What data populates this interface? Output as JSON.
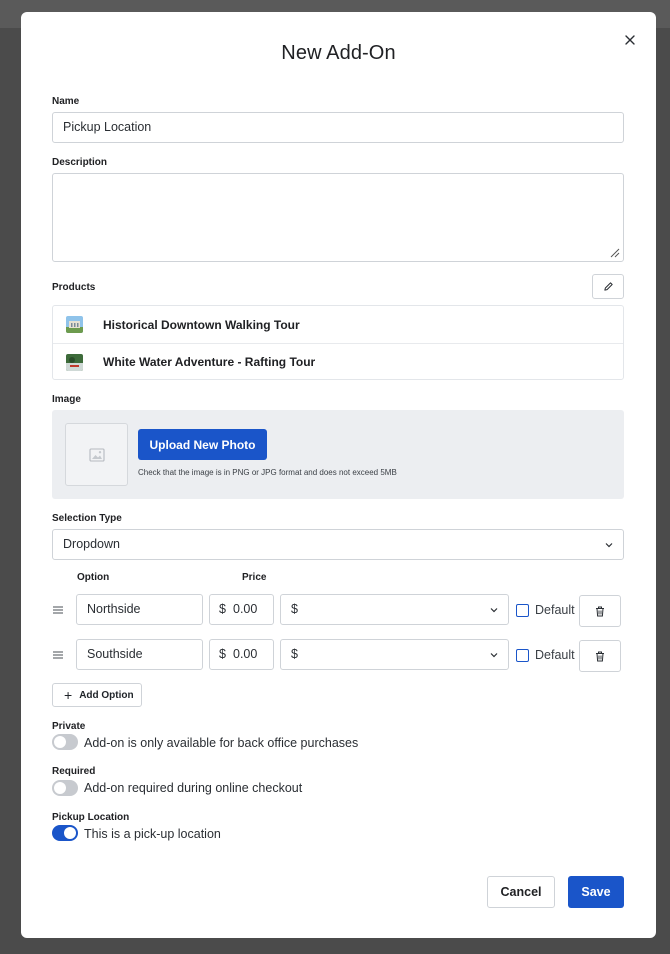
{
  "modal": {
    "title": "New Add-On",
    "close_icon": "close-icon"
  },
  "name": {
    "label": "Name",
    "value": "Pickup Location"
  },
  "description": {
    "label": "Description",
    "value": ""
  },
  "products": {
    "label": "Products",
    "edit_icon": "pencil-icon",
    "items": [
      {
        "name": "Historical Downtown Walking Tour"
      },
      {
        "name": "White Water Adventure - Rafting Tour"
      }
    ]
  },
  "image": {
    "label": "Image",
    "placeholder_icon": "image-placeholder-icon",
    "upload_label": "Upload New Photo",
    "hint": "Check that the image is in PNG or JPG format and does not exceed 5MB"
  },
  "selection_type": {
    "label": "Selection Type",
    "value": "Dropdown"
  },
  "options": {
    "col_option": "Option",
    "col_price": "Price",
    "rows": [
      {
        "name": "Northside",
        "currency_symbol": "$",
        "price": "0.00",
        "currency": "$",
        "default_label": "Default",
        "default_checked": false
      },
      {
        "name": "Southside",
        "currency_symbol": "$",
        "price": "0.00",
        "currency": "$",
        "default_label": "Default",
        "default_checked": false
      }
    ],
    "add_label": "Add Option"
  },
  "private": {
    "label": "Private",
    "text": "Add-on is only available for back office purchases",
    "on": false
  },
  "required": {
    "label": "Required",
    "text": "Add-on required during online checkout",
    "on": false
  },
  "pickup": {
    "label": "Pickup Location",
    "text": "This is a pick-up location",
    "on": true
  },
  "footer": {
    "cancel_label": "Cancel",
    "save_label": "Save"
  },
  "colors": {
    "primary": "#1a55c9",
    "backdrop": "#4b4b4b"
  }
}
